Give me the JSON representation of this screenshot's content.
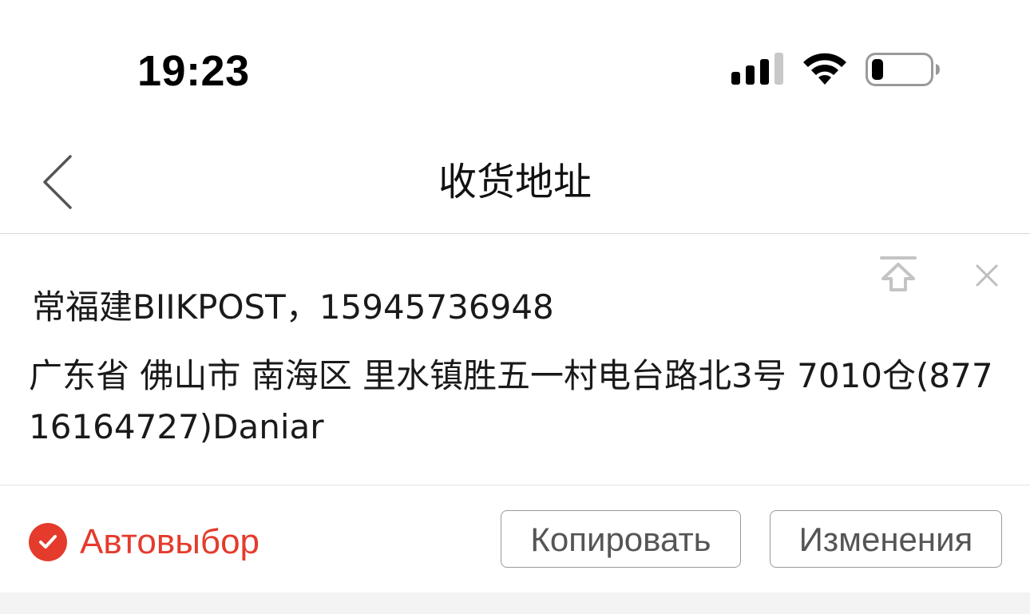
{
  "status_bar": {
    "time": "19:23",
    "signal_icon": "cellular-signal-icon",
    "wifi_icon": "wifi-icon",
    "battery_icon": "battery-low-icon"
  },
  "nav": {
    "back_icon": "chevron-left-icon",
    "title": "收货地址"
  },
  "address_card": {
    "pin_top_icon": "pin-to-top-icon",
    "close_icon": "close-icon",
    "recipient": "常福建BIIKPOST，15945736948",
    "address": "广东省 佛山市 南海区 里水镇胜五一村电台路北3号 7010仓(87716164727)Daniar"
  },
  "actions": {
    "auto_select_label": "Автовыбор",
    "auto_select_checked": true,
    "copy_label": "Копировать",
    "edit_label": "Изменения"
  },
  "colors": {
    "accent": "#e53b2c",
    "divider": "#d9d9d9",
    "button_border": "#999999",
    "footer": "#f3f3f3"
  }
}
